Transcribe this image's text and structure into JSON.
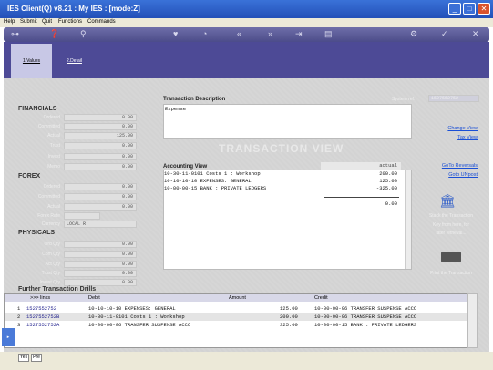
{
  "window": {
    "title": "IES Client(Q) v8.21 : My IES :        [mode:Z]"
  },
  "menu": [
    "Help",
    "Submit",
    "Quit",
    "Functions",
    "Commands"
  ],
  "tabs": [
    "1.Values",
    "2.Detail"
  ],
  "financials": {
    "heading": "FINANCIALS",
    "rows": [
      {
        "label": "Ordered",
        "value": "0.00"
      },
      {
        "label": "Committed",
        "value": "0.00"
      },
      {
        "label": "Actual",
        "value": "125.00"
      },
      {
        "label": "Trust",
        "value": "0.00"
      },
      {
        "label": "Invest",
        "value": "0.00"
      },
      {
        "label": "Memo",
        "value": "0.00"
      }
    ]
  },
  "forex": {
    "heading": "FOREX",
    "rows": [
      {
        "label": "Ordered",
        "value": "0.00"
      },
      {
        "label": "Committed",
        "value": "0.00"
      },
      {
        "label": "Actual",
        "value": "0.00"
      },
      {
        "label": "Forex Rate",
        "value": ""
      },
      {
        "label": "Currency",
        "value": "LOCAL R"
      }
    ]
  },
  "physicals": {
    "heading": "PHYSICALS",
    "rows": [
      {
        "label": "Ord Qty",
        "value": "0.00"
      },
      {
        "label": "Com Qty",
        "value": "0.00"
      },
      {
        "label": "Act Qty",
        "value": "0.00"
      },
      {
        "label": "Trust Qty",
        "value": "0.00"
      },
      {
        "label": "Invest Qty",
        "value": "0.00"
      }
    ]
  },
  "transaction": {
    "desc_label": "Transaction Description",
    "desc_value": "Expense",
    "system_ref_label": "System ref:",
    "system_ref_value": "1527552752",
    "view_title": "TRANSACTION VIEW"
  },
  "accounting": {
    "label": "Accounting View",
    "column_header": "actual",
    "lines": [
      {
        "account": "10-30-11-0101 Costs 1 : Workshop",
        "amount": "200.00"
      },
      {
        "account": "10-10-10-10 EXPENSES: GENERAL",
        "amount": "125.00"
      },
      {
        "account": "10-00-00-15 BANK : PRIVATE LEDGERS",
        "amount": "-325.00"
      }
    ],
    "total": "0.00"
  },
  "side_links": {
    "change_view": "Change View",
    "tax_view": "Tax View",
    "goto_reversals": "GoTo Reversals",
    "goto_unpost": "Goto UNpost",
    "stack_text": [
      "Stack the Transaction",
      "Key from here, for",
      "later retrieval..."
    ],
    "print_text": "Print the Transaction"
  },
  "drills": {
    "heading": "Further Transaction Drills",
    "columns": [
      ">>> links",
      "Debit",
      "Amount",
      "Credit"
    ],
    "rows": [
      {
        "n": "1",
        "link": "1527552752",
        "debit": "10-10-10-10 EXPENSES: GENERAL",
        "amount": "125.00",
        "credit": "10-00-00-06 TRANSFER SUSPENSE ACCO"
      },
      {
        "n": "2",
        "link": "1527552752B",
        "debit": "10-30-11-0101 Costs 1 : Workshop",
        "amount": "200.00",
        "credit": "10-00-00-06 TRANSFER SUSPENSE ACCO"
      },
      {
        "n": "3",
        "link": "1527552752A",
        "debit": "10-00-00-06 TRANSFER SUSPENSE ACCO",
        "amount": "325.00",
        "credit": "10-00-00-15 BANK : PRIVATE LEDGERS"
      }
    ]
  },
  "status": {
    "btn1": "Yes",
    "btn2": "Pre"
  },
  "colors": {
    "titlebar": "#2a5ac8",
    "tabbar": "#4d4a96",
    "panel": "#d3d3d3",
    "link": "#1a4fd6"
  }
}
